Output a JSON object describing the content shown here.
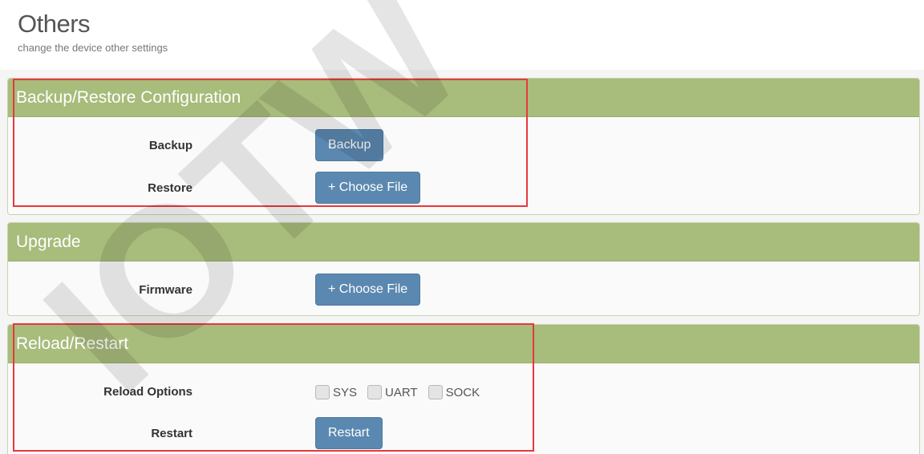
{
  "header": {
    "title": "Others",
    "subtitle": "change the device other settings"
  },
  "backup_restore": {
    "heading": "Backup/Restore Configuration",
    "backup_label": "Backup",
    "backup_button": "Backup",
    "restore_label": "Restore",
    "restore_button": "+ Choose File"
  },
  "upgrade": {
    "heading": "Upgrade",
    "firmware_label": "Firmware",
    "firmware_button": "+ Choose File"
  },
  "reload_restart": {
    "heading": "Reload/Restart",
    "reload_label": "Reload Options",
    "options": [
      "SYS",
      "UART",
      "SOCK"
    ],
    "restart_label": "Restart",
    "restart_button": "Restart"
  },
  "watermark": {
    "text": "IOTW"
  },
  "colors": {
    "panel_heading": "#a8bc7b",
    "button": "#5b88b0",
    "highlight_frame": "#e8383d"
  }
}
